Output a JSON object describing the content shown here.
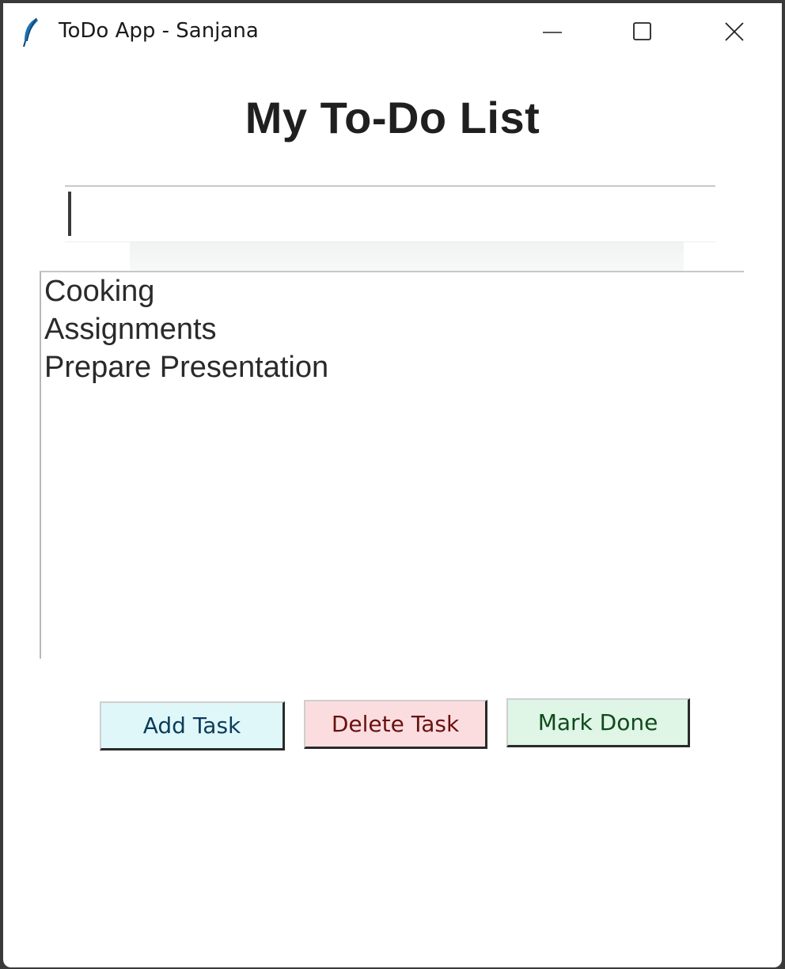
{
  "window": {
    "title": "ToDo App - Sanjana",
    "icon": "feather-icon",
    "controls": [
      "minimize-icon",
      "maximize-icon",
      "close-icon"
    ]
  },
  "main": {
    "heading": "My To-Do List",
    "task_input": {
      "value": "",
      "placeholder": ""
    },
    "tasks": [
      "Cooking",
      "Assignments",
      "Prepare Presentation"
    ],
    "buttons": {
      "add_label": "Add Task",
      "delete_label": "Delete Task",
      "done_label": "Mark Done"
    }
  },
  "colors": {
    "add_button_bg": "#e0f7fa",
    "delete_button_bg": "#fbdde0",
    "done_button_bg": "#dff5e6",
    "icon_blue": "#1e6fb0"
  }
}
